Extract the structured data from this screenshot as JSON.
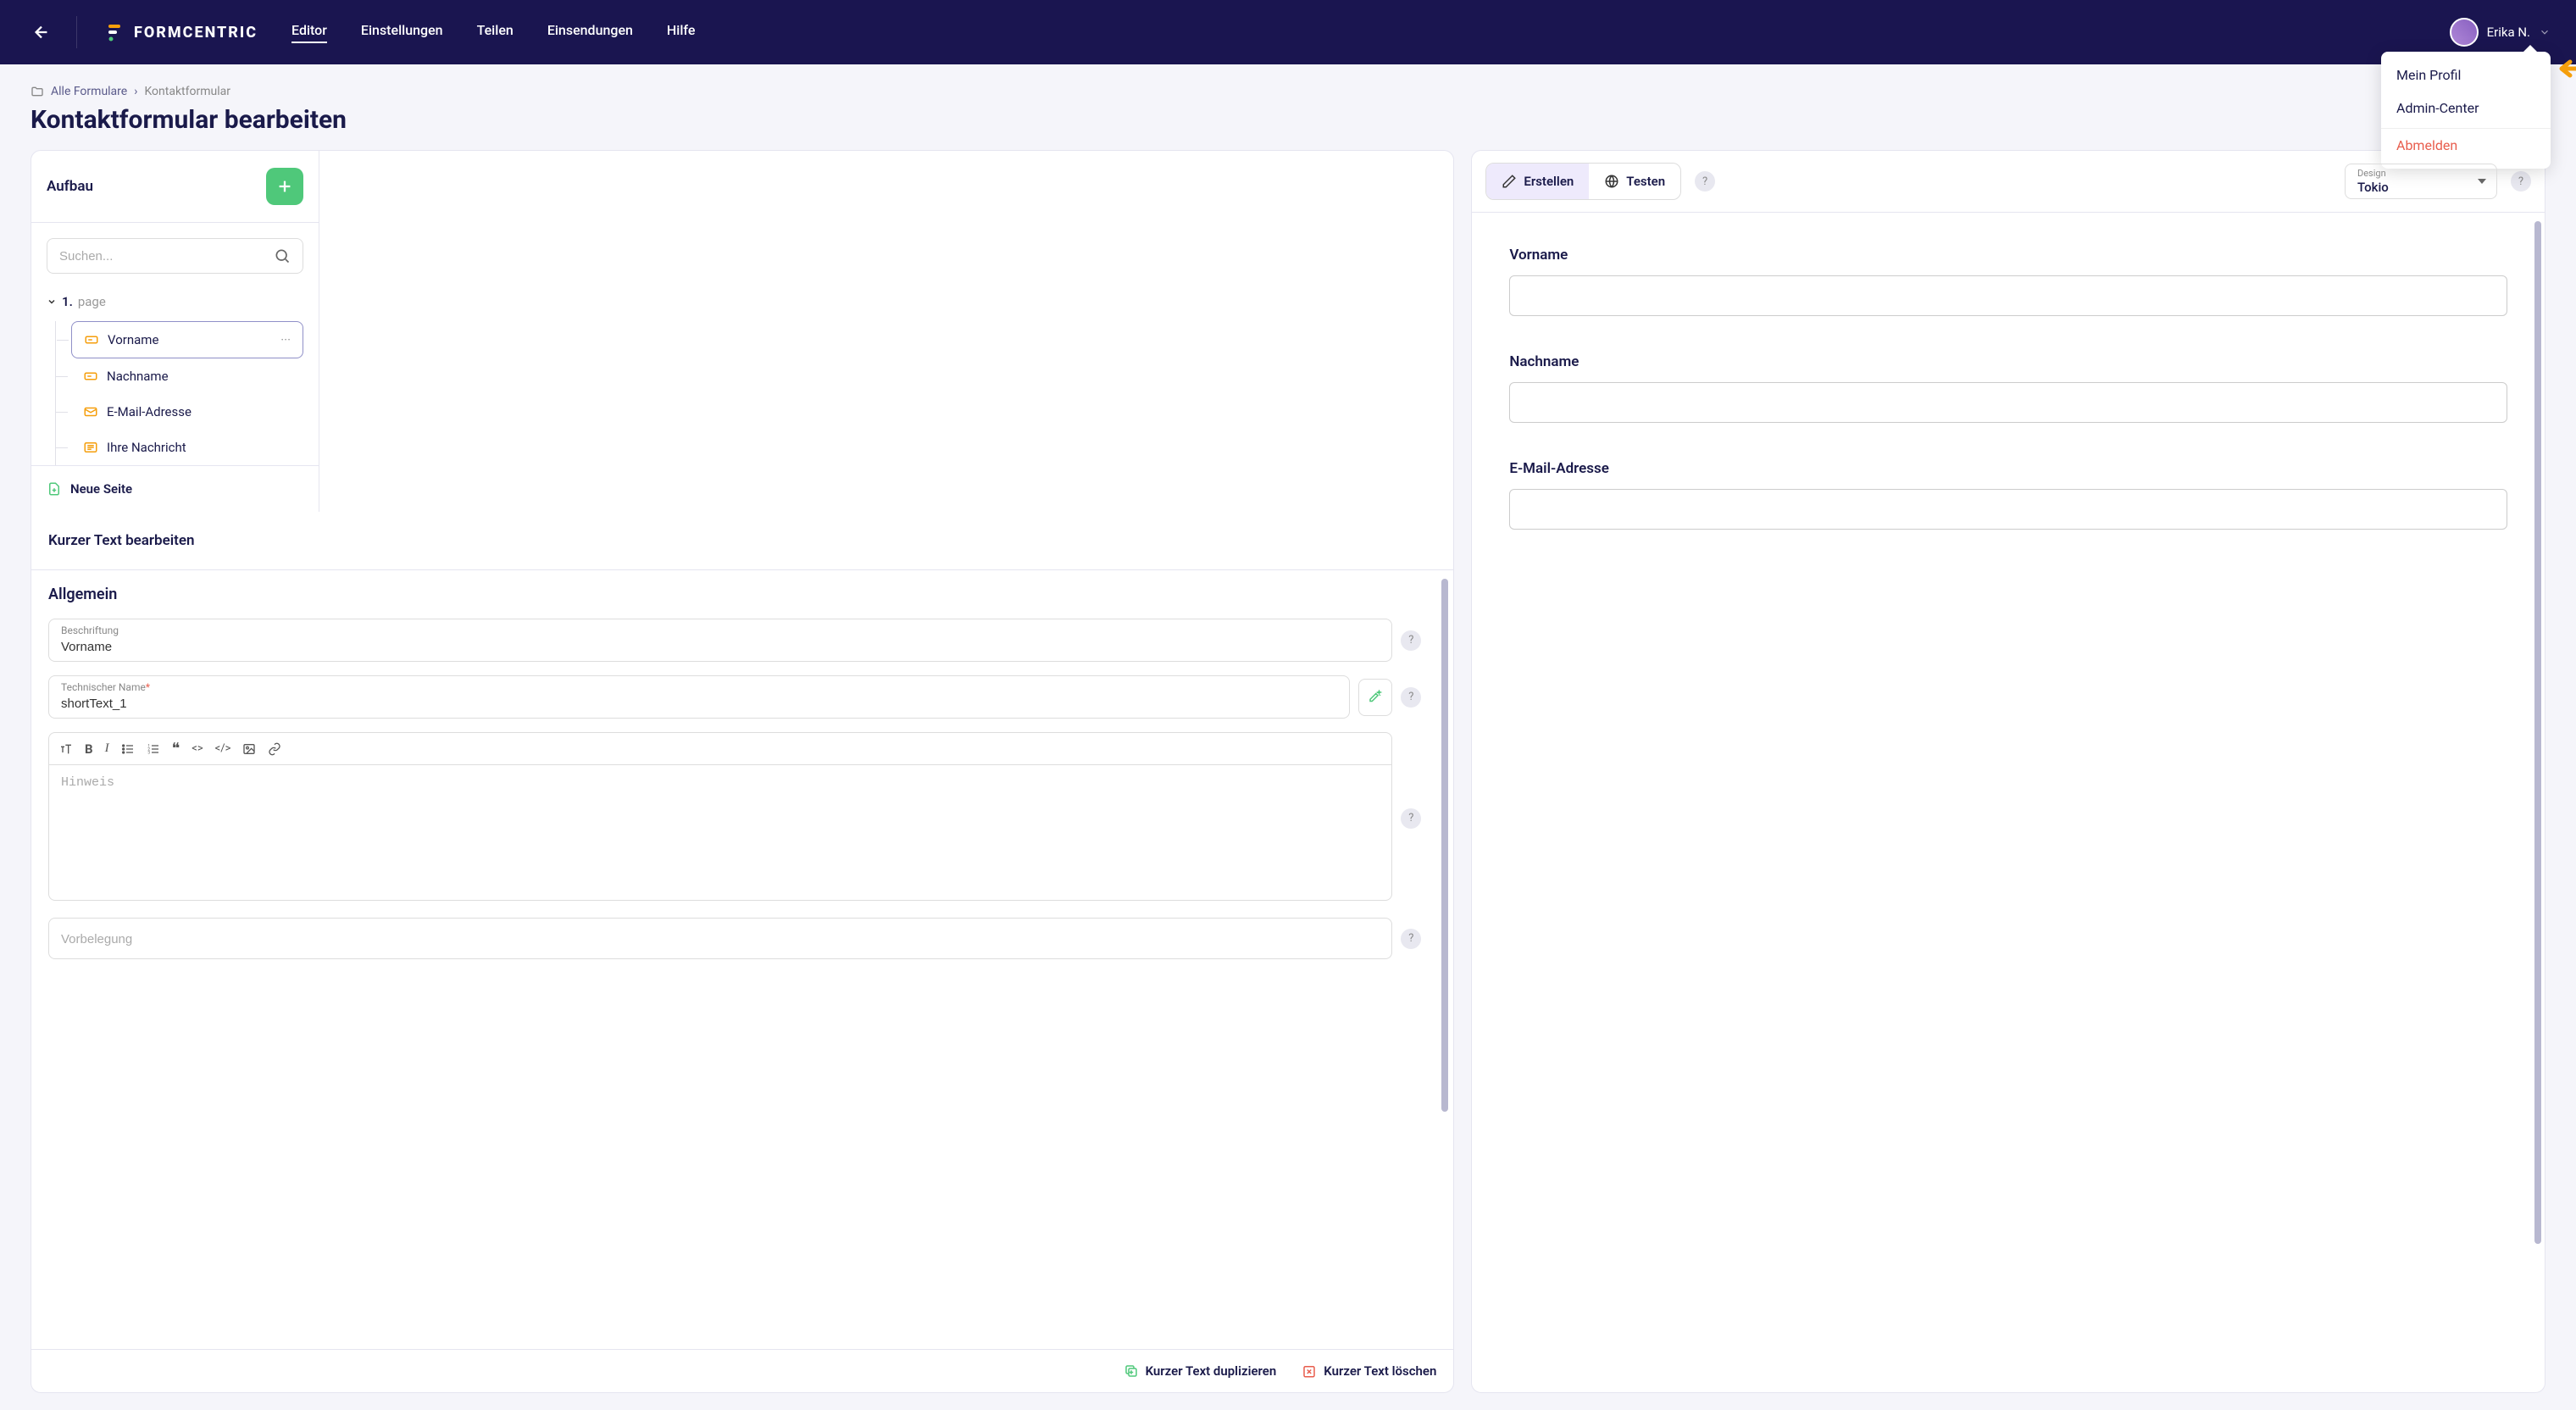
{
  "brand": "FORMCENTRIC",
  "nav": {
    "editor": "Editor",
    "settings": "Einstellungen",
    "share": "Teilen",
    "submissions": "Einsendungen",
    "help": "Hilfe"
  },
  "user": {
    "name": "Erika N.",
    "menu": {
      "profile": "Mein Profil",
      "admin": "Admin-Center",
      "logout": "Abmelden"
    }
  },
  "breadcrumb": {
    "root": "Alle Formulare",
    "current": "Kontaktformular"
  },
  "page_title": "Kontaktformular bearbeiten",
  "structure": {
    "title": "Aufbau",
    "search_placeholder": "Suchen...",
    "page_num": "1.",
    "page_label": "page",
    "items": [
      {
        "label": "Vorname",
        "type": "input",
        "selected": true
      },
      {
        "label": "Nachname",
        "type": "input",
        "selected": false
      },
      {
        "label": "E-Mail-Adresse",
        "type": "email",
        "selected": false
      },
      {
        "label": "Ihre Nachricht",
        "type": "textarea",
        "selected": false
      }
    ],
    "new_page": "Neue Seite"
  },
  "props": {
    "title": "Kurzer Text bearbeiten",
    "section": "Allgemein",
    "label_field": {
      "label": "Beschriftung",
      "value": "Vorname"
    },
    "tech_field": {
      "label": "Technischer Name",
      "value": "shortText_1"
    },
    "hint_placeholder": "Hinweis",
    "prefill_placeholder": "Vorbelegung",
    "duplicate": "Kurzer Text duplizieren",
    "delete": "Kurzer Text löschen"
  },
  "preview": {
    "create": "Erstellen",
    "test": "Testen",
    "design_label": "Design",
    "design_value": "Tokio",
    "fields": [
      {
        "label": "Vorname"
      },
      {
        "label": "Nachname"
      },
      {
        "label": "E-Mail-Adresse"
      }
    ]
  }
}
